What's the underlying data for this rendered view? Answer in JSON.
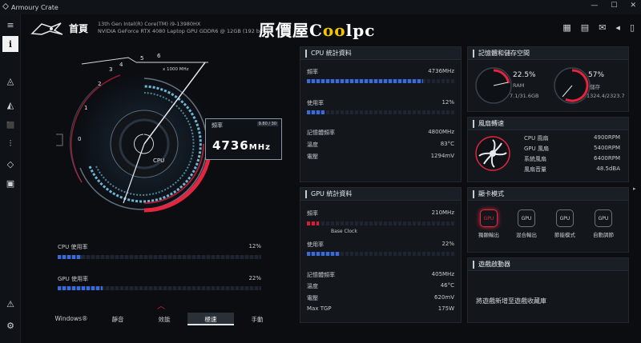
{
  "window": {
    "title": "Armoury Crate",
    "controls": [
      "—",
      "☐",
      "✕"
    ]
  },
  "sidebar": {
    "items": [
      {
        "name": "menu-icon",
        "glyph": "≡"
      },
      {
        "name": "home-icon",
        "glyph": "i"
      },
      {
        "name": "device-icon",
        "glyph": "◬"
      },
      {
        "name": "aura-icon",
        "glyph": "◭"
      },
      {
        "name": "scenario-icon",
        "glyph": "⬛"
      },
      {
        "name": "sliders-icon",
        "glyph": "⫶"
      },
      {
        "name": "tag-icon",
        "glyph": "◇"
      },
      {
        "name": "card-icon",
        "glyph": "▣"
      },
      {
        "name": "user-icon",
        "glyph": "⚠"
      },
      {
        "name": "settings-icon",
        "glyph": "⚙"
      }
    ]
  },
  "header": {
    "title": "首頁",
    "cpu_spec": "13th Gen Intel(R) Core(TM) i9-13980HX",
    "gpu_spec": "NVIDIA GeForce RTX 4080 Laptop GPU GDDR6 @ 12GB (192 bits)",
    "watermark": "原價屋",
    "watermark_brand_a": "C",
    "watermark_brand_accent": "oo",
    "watermark_brand_b": "lpc"
  },
  "gauge": {
    "scale_label": "x 1000 MHz",
    "ticks": [
      "0",
      "1",
      "2",
      "3",
      "4",
      "5",
      "6"
    ],
    "center_label": "CPU",
    "freq_label": "頻率",
    "freq_tag": "9.80 / 30",
    "freq_value": "4736",
    "freq_unit": "MHz"
  },
  "left_stats": {
    "cpu_usage_label": "CPU 使用率",
    "cpu_usage_value": "12%",
    "cpu_usage_pct": 12,
    "gpu_usage_label": "GPU 使用率",
    "gpu_usage_value": "22%",
    "gpu_usage_pct": 22
  },
  "modes": {
    "items": [
      "Windows®",
      "靜音",
      "效能",
      "極速",
      "手動"
    ],
    "active_index": 3
  },
  "cpu_panel": {
    "title": "CPU 統計資料",
    "freq_label": "頻率",
    "freq_value": "4736MHz",
    "freq_pct": 78,
    "usage_label": "使用率",
    "usage_value": "12%",
    "usage_pct": 12,
    "mem_freq_label": "記憶體頻率",
    "mem_freq_value": "4800MHz",
    "temp_label": "溫度",
    "temp_value": "83°C",
    "volt_label": "電壓",
    "volt_value": "1294mV"
  },
  "gpu_panel": {
    "title": "GPU 統計資料",
    "freq_label": "頻率",
    "freq_value": "210MHz",
    "freq_pct": 8,
    "base_clock_label": "Base Clock",
    "usage_label": "使用率",
    "usage_value": "22%",
    "usage_pct": 22,
    "mem_freq_label": "記憶體頻率",
    "mem_freq_value": "405MHz",
    "temp_label": "溫度",
    "temp_value": "46°C",
    "volt_label": "電壓",
    "volt_value": "620mV",
    "tgp_label": "Max TGP",
    "tgp_value": "175W"
  },
  "memory_panel": {
    "title": "記憶體和儲存空間",
    "ram_pct_text": "22.5%",
    "ram_label": "RAM",
    "ram_detail": "7.1/31.6GB",
    "ram_pct": 22.5,
    "storage_pct_text": "57%",
    "storage_label": "儲存",
    "storage_detail": "1324.4/2323.7",
    "storage_pct": 57
  },
  "fan_panel": {
    "title": "風扇轉速",
    "rows": [
      {
        "label": "CPU 風扇",
        "value": "4900RPM"
      },
      {
        "label": "GPU 風扇",
        "value": "5400RPM"
      },
      {
        "label": "系統風扇",
        "value": "6400RPM"
      },
      {
        "label": "風扇音量",
        "value": "48.5dBA"
      }
    ]
  },
  "gpu_mode_panel": {
    "title": "顯卡模式",
    "modes": [
      {
        "label": "獨顯輸出",
        "icon": "GPU"
      },
      {
        "label": "混合輸出",
        "icon": "GPU"
      },
      {
        "label": "節能模式",
        "icon": "GPU"
      },
      {
        "label": "自動調節",
        "icon": "GPU"
      }
    ],
    "active_index": 0
  },
  "launcher_panel": {
    "title": "遊戲啟動器",
    "message": "將遊戲新增至遊戲收藏庫"
  },
  "colors": {
    "accent_red": "#e3253f",
    "accent_blue": "#3a6bd8",
    "bg": "#0b0d11"
  }
}
